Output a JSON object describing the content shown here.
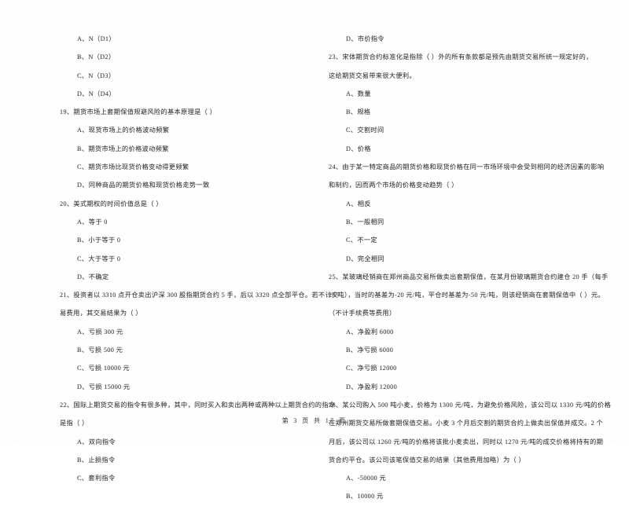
{
  "document": {
    "type": "exam-paper-scan",
    "footer": "第 3 页 共 17 页"
  },
  "left_column": {
    "lines": [
      {
        "kind": "option",
        "text": "A、N（D1）"
      },
      {
        "kind": "option",
        "text": "B、N（D2）"
      },
      {
        "kind": "option",
        "text": "C、N（D3）"
      },
      {
        "kind": "option",
        "text": "D、N（D4）"
      },
      {
        "kind": "stem",
        "text": "19、期货市场上套期保值规避风险的基本原理是（     ）"
      },
      {
        "kind": "option",
        "text": "A、现货市场上的价格波动频繁"
      },
      {
        "kind": "option",
        "text": "B、期货市场上的价格波动频繁"
      },
      {
        "kind": "option",
        "text": "C、期货市场比现货价格变动得更频繁"
      },
      {
        "kind": "option",
        "text": "D、同种商品的期货价格和现货价格走势一致"
      },
      {
        "kind": "stem",
        "text": "20、美式期权的时间价值总是（     ）"
      },
      {
        "kind": "option",
        "text": "A、等于 0"
      },
      {
        "kind": "option",
        "text": "B、小于等于 0"
      },
      {
        "kind": "option",
        "text": "C、大于等于 0"
      },
      {
        "kind": "option",
        "text": "D、不确定"
      },
      {
        "kind": "stem",
        "text": "21、投资者以 3310 点开仓卖出沪深 300 股指期货合约 5 手，后以 3320 点全部平仓。若不计交"
      },
      {
        "kind": "cont",
        "text": "易费用，其交易结果为（     ）"
      },
      {
        "kind": "option",
        "text": "A、亏损 300 元"
      },
      {
        "kind": "option",
        "text": "B、亏损 500 元"
      },
      {
        "kind": "option",
        "text": "C、亏损 10000 元"
      },
      {
        "kind": "option",
        "text": "D、亏损 15000 元"
      },
      {
        "kind": "stem",
        "text": "22、国际上期货交易的指令有很多种，其中，同时买入和卖出两种或两种以上期货合约的指令"
      },
      {
        "kind": "cont",
        "text": "是指（     ）"
      },
      {
        "kind": "option",
        "text": "A、双向指令"
      },
      {
        "kind": "option",
        "text": "B、止损指令"
      },
      {
        "kind": "option",
        "text": "C、套利指令"
      }
    ]
  },
  "right_column": {
    "lines": [
      {
        "kind": "option",
        "text": "D、市价指令"
      },
      {
        "kind": "stem",
        "text": "23、宋体期货合约标准化是指除（     ）外的所有条款都是预先由期货交易所统一规定好的，"
      },
      {
        "kind": "cont",
        "text": "这给期货交易带来很大便利。"
      },
      {
        "kind": "option",
        "text": "A、数量"
      },
      {
        "kind": "option",
        "text": "B、规格"
      },
      {
        "kind": "option",
        "text": "C、交割时间"
      },
      {
        "kind": "option",
        "text": "D、价格"
      },
      {
        "kind": "stem",
        "text": "24、由于某一特定商品的期货价格和现货价格在同一市场环境中会受到相同的经济因素的影响"
      },
      {
        "kind": "cont",
        "text": "和制约，因而两个市场的价格变动趋势（     ）"
      },
      {
        "kind": "option",
        "text": "A、相反"
      },
      {
        "kind": "option",
        "text": "B、一般相同"
      },
      {
        "kind": "option",
        "text": "C、不一定"
      },
      {
        "kind": "option",
        "text": "D、完全相同"
      },
      {
        "kind": "stem",
        "text": "25、某玻璃经销商在郑州商品交易所做卖出套期保值，在某月份玻璃期货合约建仓 20 手（每手"
      },
      {
        "kind": "cont",
        "text": "20 吨），当时的基差为-20 元/吨，平仓时基差为-50 元/吨，则该经销商在套期保值中（     ）元。"
      },
      {
        "kind": "cont",
        "text": "（不计手续费等费用）"
      },
      {
        "kind": "option",
        "text": "A、净盈利 6000"
      },
      {
        "kind": "option",
        "text": "B、净亏损 6000"
      },
      {
        "kind": "option",
        "text": "C、净亏损 12000"
      },
      {
        "kind": "option",
        "text": "D、净盈利 12000"
      },
      {
        "kind": "stem",
        "text": "26、某公司购入 500 吨小麦，价格为 1300 元/吨，为避免价格风险，该公司以 1330 元/吨的价格"
      },
      {
        "kind": "cont",
        "text": "在郑州期货交易所做套期保值交易。小麦 3 个月后交割的期货合约上做卖出保值并成交。2 个"
      },
      {
        "kind": "cont",
        "text": "月后，该公司以 1260 元/吨的价格将该批小麦卖出，同时以 1270 元/吨的成交价格将持有的期"
      },
      {
        "kind": "cont",
        "text": "货合约平仓。该公司该笔保值交易的结果（其他费用加略）为（     ）"
      },
      {
        "kind": "option",
        "text": "A、-50000 元"
      },
      {
        "kind": "option",
        "text": "B、10000 元"
      }
    ]
  }
}
